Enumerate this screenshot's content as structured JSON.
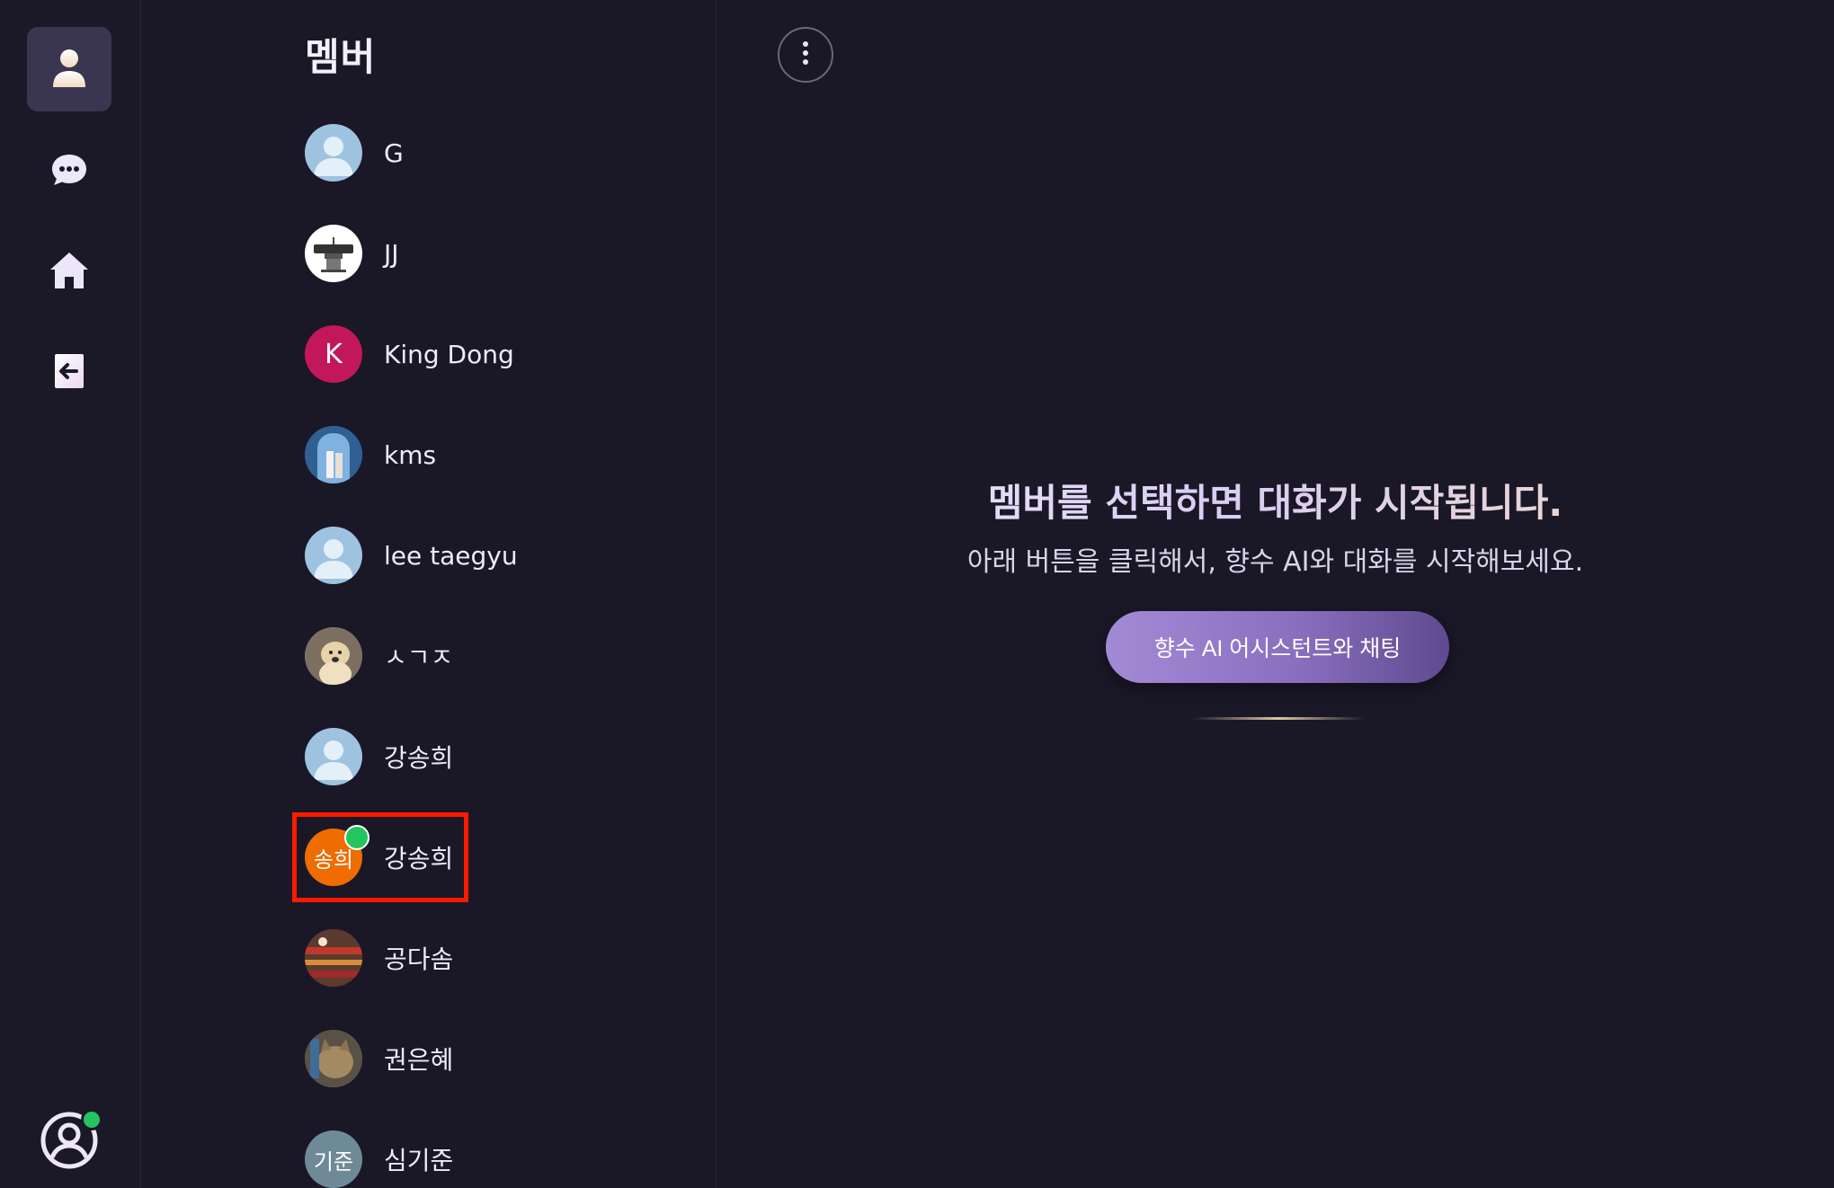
{
  "rail": {
    "items": [
      {
        "name": "members",
        "icon": "person-icon",
        "active": true
      },
      {
        "name": "chats",
        "icon": "chat-bubble-icon",
        "active": false
      },
      {
        "name": "home",
        "icon": "home-icon",
        "active": false
      },
      {
        "name": "logout",
        "icon": "exit-arrow-icon",
        "active": false
      }
    ],
    "profile_icon": "user-circle-icon",
    "profile_online": true
  },
  "members_panel": {
    "title": "멤버",
    "more_icon": "vertical-dots-icon",
    "items": [
      {
        "name": "G",
        "avatar_type": "default",
        "avatar_text": ""
      },
      {
        "name": "JJ",
        "avatar_type": "image",
        "avatar_text": ""
      },
      {
        "name": "King Dong",
        "avatar_type": "initial",
        "avatar_text": "K",
        "avatar_color": "#c2185b"
      },
      {
        "name": "kms",
        "avatar_type": "image",
        "avatar_text": ""
      },
      {
        "name": "lee taegyu",
        "avatar_type": "default",
        "avatar_text": ""
      },
      {
        "name": "ㅅㄱㅈ",
        "avatar_type": "image",
        "avatar_text": ""
      },
      {
        "name": "강송희",
        "avatar_type": "default",
        "avatar_text": ""
      },
      {
        "name": "강송희",
        "avatar_type": "initial",
        "avatar_text": "송희",
        "avatar_color": "#ef6c00",
        "online": true,
        "highlighted": true
      },
      {
        "name": "공다솜",
        "avatar_type": "image",
        "avatar_text": ""
      },
      {
        "name": "권은혜",
        "avatar_type": "image",
        "avatar_text": ""
      },
      {
        "name": "심기준",
        "avatar_type": "initial",
        "avatar_text": "기준",
        "avatar_color": "#6f8a97"
      }
    ]
  },
  "main": {
    "empty_title": "멤버를 선택하면 대화가 시작됩니다.",
    "empty_subtitle": "아래 버튼을 클릭해서, 향수 AI와 대화를 시작해보세요.",
    "cta_label": "향수 AI 어시스턴트와 채팅"
  },
  "colors": {
    "background": "#1a1727",
    "accent": "#9a80cf",
    "online": "#22c55e",
    "highlight": "#ff1a00"
  }
}
